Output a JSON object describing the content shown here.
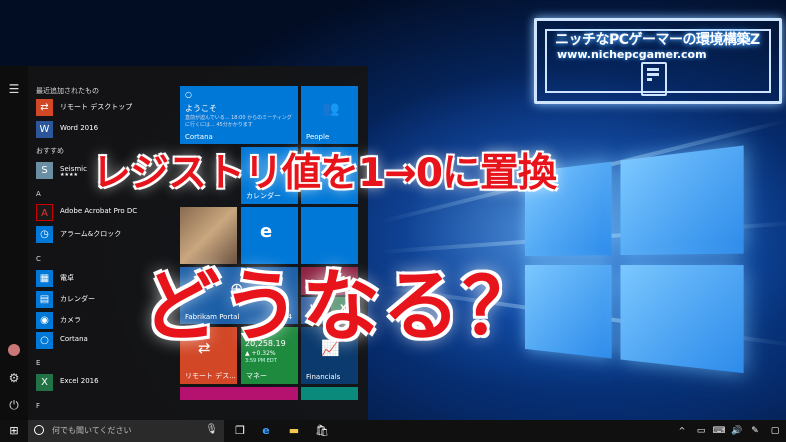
{
  "headline": {
    "line1": "レジストリ値を1→0に置換",
    "line2": "どうなる？"
  },
  "badge": {
    "title": "ニッチなPCゲーマーの環境構築Z",
    "url": "www.nichepcgamer.com",
    "icon": "pc-icon"
  },
  "start_menu": {
    "sections": {
      "recent": "最近追加されたもの",
      "suggested": "おすすめ",
      "a": "A",
      "c": "C",
      "e": "E",
      "f": "F"
    },
    "apps": {
      "remote_desktop": "リモート デスクトップ",
      "word": "Word 2016",
      "seismic": "Seismic",
      "seismic_rating": "★★★★",
      "acrobat": "Adobe Acrobat Pro DC",
      "alarm": "アラーム&クロック",
      "calculator": "電卓",
      "calendar": "カレンダー",
      "camera": "カメラ",
      "cortana": "Cortana",
      "excel": "Excel 2016"
    },
    "tiles": {
      "cortana_greeting": "ようこそ",
      "cortana_text": "直前が迫んでいる... 18:00 からのミーティングに行くには... 45分かかります",
      "cortana_label": "Cortana",
      "people": "People",
      "calendar": "カレンダー",
      "fabrikam": "Fabrikam Portal",
      "fabrikam_count": "4",
      "remote_desktop": "リモート デス...",
      "stock_name": "DOW",
      "stock_value": "20,258.19",
      "stock_change": "▲ +0.32%",
      "stock_time": "3:59 PM EDT",
      "money": "マネー",
      "financials": "Financials"
    }
  },
  "taskbar": {
    "search_placeholder": "何でも聞いてください"
  },
  "colors": {
    "accent": "#0078d7",
    "headline_red": "#e8141c"
  }
}
